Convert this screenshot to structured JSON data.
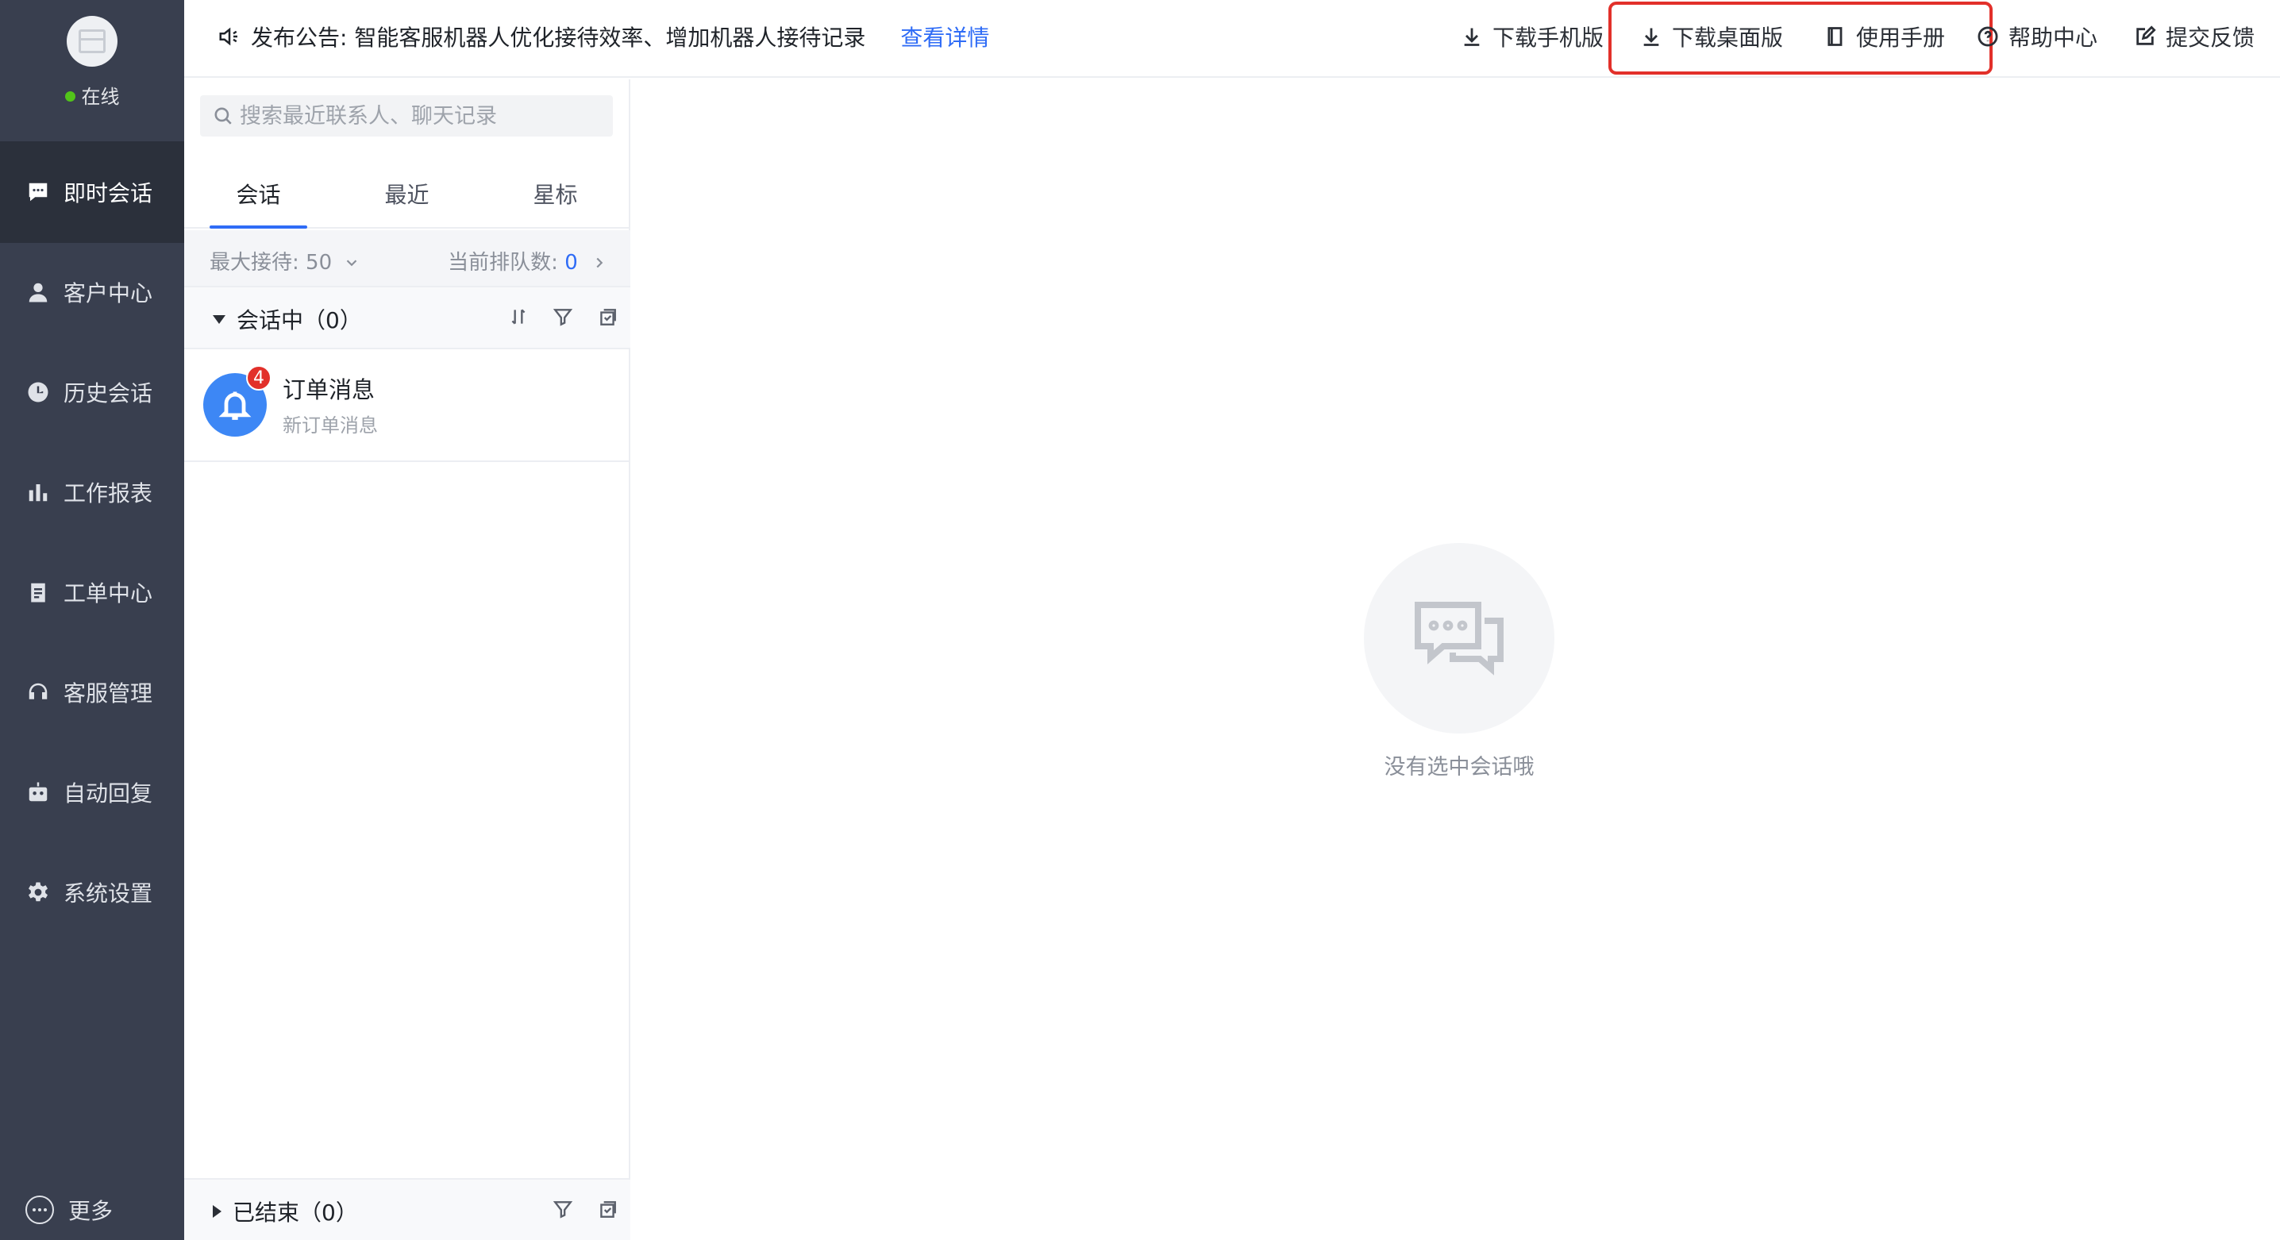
{
  "nav": {
    "status": "在线",
    "items": [
      {
        "label": "即时会话",
        "icon": "chat-bubble-icon"
      },
      {
        "label": "客户中心",
        "icon": "user-icon"
      },
      {
        "label": "历史会话",
        "icon": "clock-icon"
      },
      {
        "label": "工作报表",
        "icon": "bar-chart-icon"
      },
      {
        "label": "工单中心",
        "icon": "clipboard-icon"
      },
      {
        "label": "客服管理",
        "icon": "headset-icon"
      },
      {
        "label": "自动回复",
        "icon": "robot-icon"
      },
      {
        "label": "系统设置",
        "icon": "gear-icon"
      }
    ],
    "more": "更多"
  },
  "topbar": {
    "announcement": "发布公告: 智能客服机器人优化接待效率、增加机器人接待记录",
    "detail_link": "查看详情",
    "links": {
      "download_mobile": "下载手机版",
      "download_desktop": "下载桌面版",
      "manual": "使用手册",
      "help": "帮助中心",
      "feedback": "提交反馈"
    },
    "highlight_color": "#e2302a"
  },
  "list": {
    "search_placeholder": "搜索最近联系人、聊天记录",
    "tabs": [
      "会话",
      "最近",
      "星标"
    ],
    "active_tab": "会话",
    "max_reception_label": "最大接待: 50",
    "queue_label": "当前排队数: ",
    "queue_count": "0",
    "in_session_label": "会话中（0）",
    "ended_label": "已结束（0）",
    "conversations": [
      {
        "name": "订单消息",
        "subtitle": "新订单消息",
        "badge": "4",
        "icon": "bell-icon"
      }
    ]
  },
  "main": {
    "empty_text": "没有选中会话哦"
  },
  "colors": {
    "accent": "#2f6cf6",
    "nav_bg": "#393f4f",
    "online": "#52c41a",
    "badge": "#e2302a"
  }
}
